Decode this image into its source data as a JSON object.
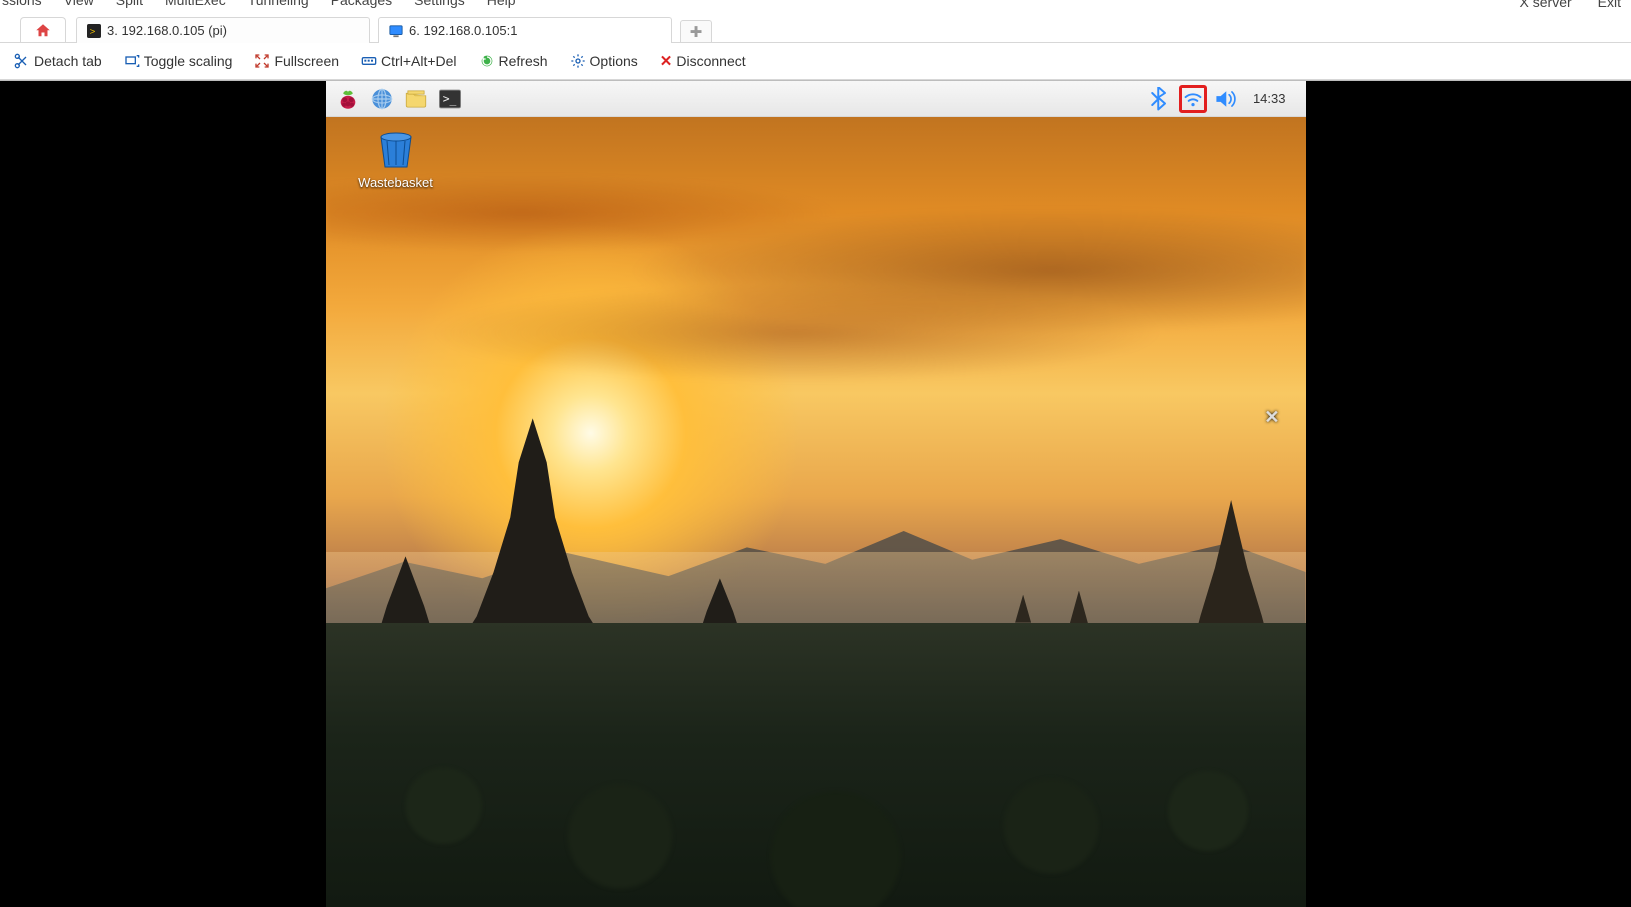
{
  "menubar": {
    "items": [
      "ssions",
      "View",
      "Split",
      "MultiExec",
      "Tunneling",
      "Packages",
      "Settings",
      "Help"
    ]
  },
  "topright": {
    "xserver": "X server",
    "exit": "Exit"
  },
  "tabs": {
    "home_tooltip": "Home",
    "items": [
      {
        "label": "3. 192.168.0.105 (pi)",
        "icon": "terminal-icon",
        "active": false
      },
      {
        "label": "6. 192.168.0.105:1",
        "icon": "vnc-icon",
        "active": true
      }
    ],
    "newtab_glyph": "✚"
  },
  "vnc_toolbar": {
    "detach": "Detach tab",
    "togglescale": "Toggle scaling",
    "fullscreen": "Fullscreen",
    "ctrlaltdel": "Ctrl+Alt+Del",
    "refresh": "Refresh",
    "options": "Options",
    "disconnect": "Disconnect"
  },
  "rpi": {
    "launchers": {
      "menu": "Raspberry Pi menu",
      "browser": "Web Browser",
      "files": "File Manager",
      "terminal": "Terminal"
    },
    "tray": {
      "bluetooth": "Bluetooth",
      "wifi": "Wireless network",
      "volume": "Volume",
      "time": "14:33"
    },
    "desktop": {
      "wastebasket": "Wastebasket"
    }
  },
  "highlight": {
    "target": "wifi"
  }
}
